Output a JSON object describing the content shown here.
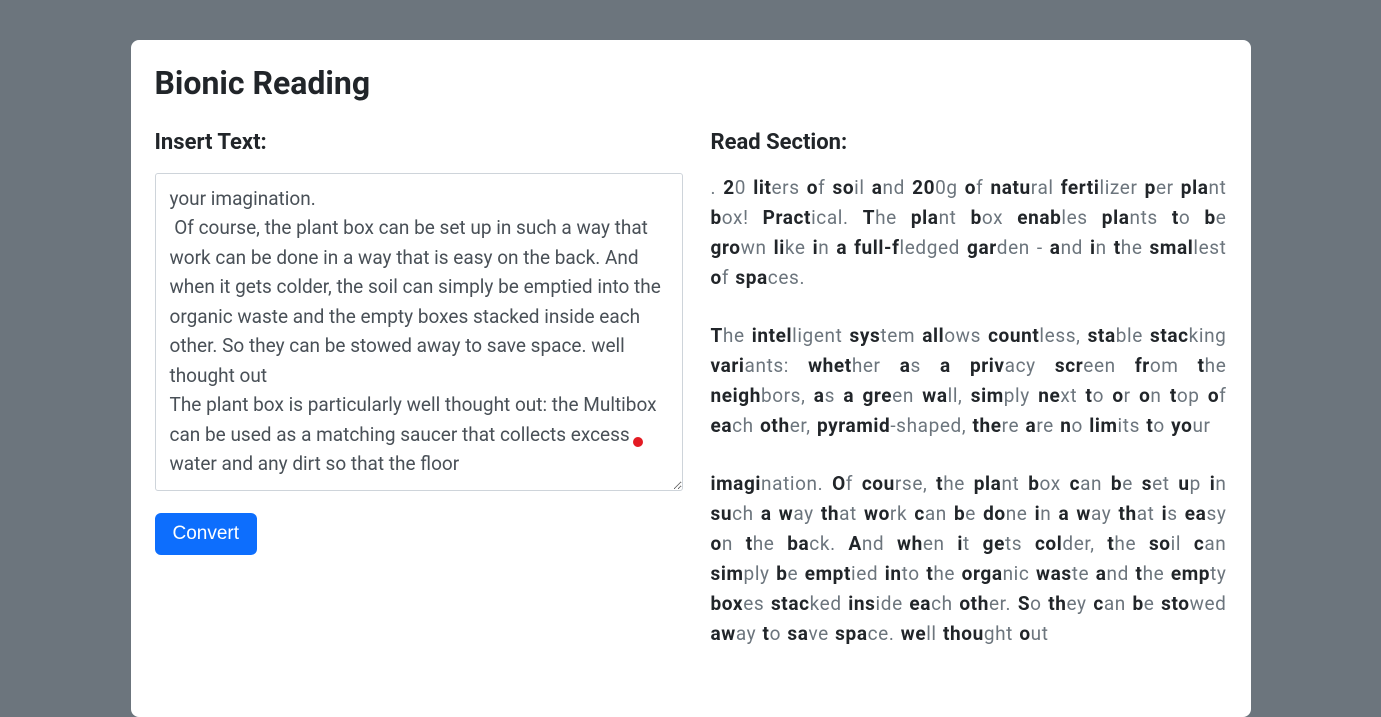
{
  "page": {
    "title": "Bionic Reading"
  },
  "left": {
    "label": "Insert Text:",
    "textarea_value": "your imagination.\n Of course, the plant box can be set up in such a way that work can be done in a way that is easy on the back. And when it gets colder, the soil can simply be emptied into the organic waste and the empty boxes stacked inside each other. So they can be stowed away to save space. well thought out\nThe plant box is particularly well thought out: the Multibox can be used as a matching saucer that collects excess water and any dirt so that the floor",
    "button_label": "Convert"
  },
  "right": {
    "label": "Read Section:",
    "paragraphs": [
      ". 20 liters of soil and 200g of natural fertilizer per plant box! Practical. The plant box enables plants to be grown like in a full-fledged garden - and in the smallest of spaces.",
      "The intelligent system allows countless, stable stacking variants: whether as a privacy screen from the neighbors, as a green wall, simply next to or on top of each other, pyramid-shaped, there are no limits to your",
      "imagination. Of course, the plant box can be set up in such a way that work can be done in a way that is easy on the back. And when it gets colder, the soil can simply be emptied into the organic waste and the empty boxes stacked inside each other. So they can be stowed away to save space. well thought out"
    ]
  }
}
